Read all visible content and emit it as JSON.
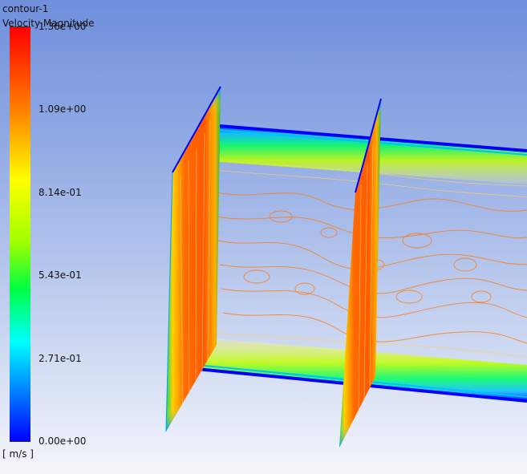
{
  "legend": {
    "title": "contour-1",
    "variable": "Velocity Magnitude",
    "units": "[ m/s ]",
    "ticks": [
      "1.36e+00",
      "1.09e+00",
      "8.14e-01",
      "5.43e-01",
      "2.71e-01",
      "0.00e+00"
    ],
    "colormap": [
      "#0000ff",
      "#0080ff",
      "#00ffff",
      "#00ff40",
      "#a0ff00",
      "#ffff00",
      "#ff8000",
      "#ff0000"
    ]
  },
  "scene": {
    "description": "3D contour plot of a rectangular duct with two cross-section planes",
    "colors": {
      "wall_edge": "#0000ff",
      "core": "#ff5a00",
      "mid": "#ffd000",
      "outer": "#00e060"
    }
  }
}
